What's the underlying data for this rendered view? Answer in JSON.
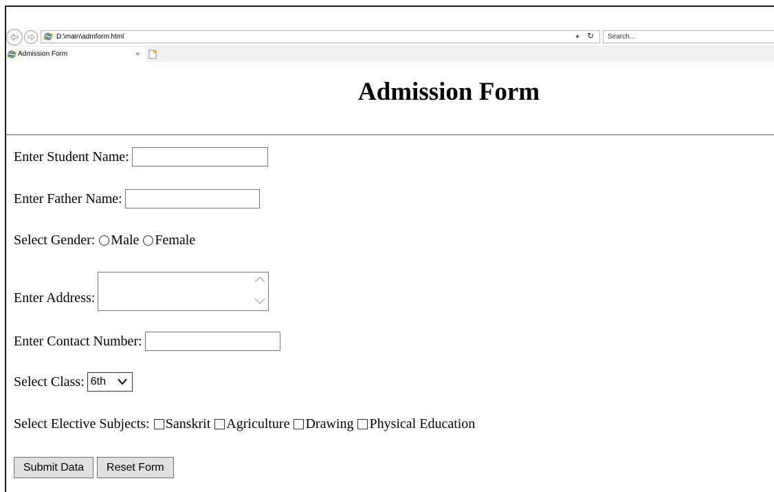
{
  "browser": {
    "url": "D:\\main\\admform.html",
    "search_placeholder": "Search...",
    "tab_title": "Admission Form",
    "tab_close": "×"
  },
  "form": {
    "title": "Admission Form",
    "student_name_label": "Enter Student Name:",
    "father_name_label": "Enter Father Name:",
    "gender_label": "Select Gender:",
    "gender_options": [
      "Male",
      "Female"
    ],
    "address_label": "Enter Address:",
    "contact_label": "Enter Contact Number:",
    "class_label": "Select Class:",
    "class_selected": "6th",
    "electives_label": "Select Elective Subjects:",
    "electives": [
      "Sanskrit",
      "Agriculture",
      "Drawing",
      "Physical Education"
    ],
    "submit_label": "Submit Data",
    "reset_label": "Reset Form"
  }
}
